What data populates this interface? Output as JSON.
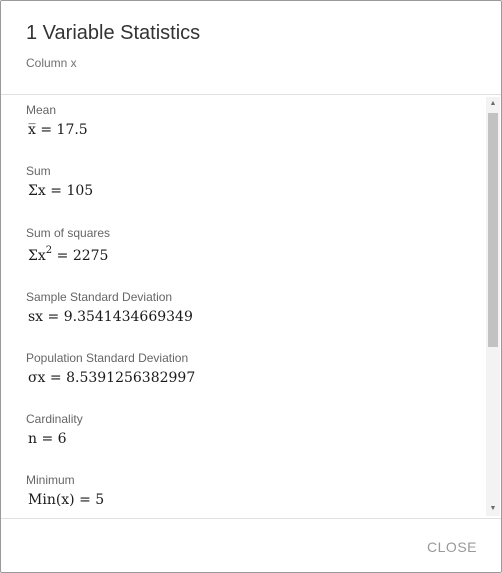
{
  "dialog": {
    "title": "1 Variable Statistics",
    "subtitle": "Column x"
  },
  "stats": [
    {
      "label": "Mean",
      "formula_lhs": "x̅ = ",
      "formula_value": "17.5"
    },
    {
      "label": "Sum",
      "formula_lhs": "Σx = ",
      "formula_value": "105"
    },
    {
      "label": "Sum of squares",
      "formula_lhs": "Σx",
      "formula_sup": "2",
      "formula_rest": " = ",
      "formula_value": "2275"
    },
    {
      "label": "Sample Standard Deviation",
      "formula_lhs": "sx = ",
      "formula_value": "9.3541434669349"
    },
    {
      "label": "Population Standard Deviation",
      "formula_lhs": "σx = ",
      "formula_value": "8.5391256382997"
    },
    {
      "label": "Cardinality",
      "formula_lhs": "n = ",
      "formula_value": "6"
    },
    {
      "label": "Minimum",
      "formula_lhs": "Min(x) = ",
      "formula_value": "5"
    }
  ],
  "scrollbar": {
    "up_arrow": "▲",
    "down_arrow": "▼"
  },
  "footer": {
    "close_label": "CLOSE"
  },
  "colors": {
    "title": "#333333",
    "label": "#666666",
    "close": "#999999",
    "divider": "#e0e0e0",
    "scroll_thumb": "#c2c2c2"
  }
}
